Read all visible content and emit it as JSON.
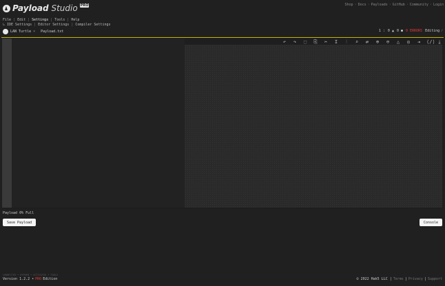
{
  "app": {
    "name_bold": "Payload",
    "name_light": "Studio",
    "badge": "PRO"
  },
  "topnav": [
    "Shop",
    "Docs",
    "Payloads",
    "GitHub",
    "Community",
    "Login"
  ],
  "menu": [
    "File",
    "Edit",
    "Settings",
    "Tools",
    "Help"
  ],
  "submenu": [
    "IDE Settings",
    "Editor Settings",
    "Compiler Settings"
  ],
  "tabs": [
    {
      "label": "LAN Turtle"
    },
    {
      "label": "Payload.txt"
    }
  ],
  "status": {
    "line": "1 :",
    "ok": "0 ▲",
    "errors": "0 ●",
    "error_label": "0 ERRORS",
    "mode": "Editing ⁄"
  },
  "toolbar_icons": [
    "undo-icon",
    "redo-icon",
    "select-all-icon",
    "copy-icon",
    "cut-icon",
    "insert-icon",
    "delay-icon",
    "search-icon",
    "replace-icon",
    "zoom-in-icon",
    "zoom-out-icon",
    "warning-icon",
    "location-icon",
    "indent-icon",
    "comment-icon",
    "download-icon"
  ],
  "toolbar_glyphs": [
    "↶",
    "↷",
    "⬚",
    "⎘",
    "✂",
    "I",
    "⫶",
    "⌕",
    "⇄",
    "⊕",
    "⊖",
    "△",
    "◎",
    "⇥",
    "⟨/⟩",
    "⤓"
  ],
  "payload_pct": "Payload 0% Full",
  "buttons": {
    "save": "Save Payload",
    "console": "Console"
  },
  "footer": {
    "small": "CONNECTED • HYPHEN • ACTIVATED • TOOLS",
    "version": "Version 1.2.2 •",
    "edition_badge": "PRO",
    "edition": "Edition",
    "copyright": "© 2022 Hak5 LLC |",
    "terms": "Terms",
    "privacy": "Privacy",
    "support": "Support"
  },
  "colors": {
    "accent": "#c9b300",
    "error": "#e53935"
  }
}
